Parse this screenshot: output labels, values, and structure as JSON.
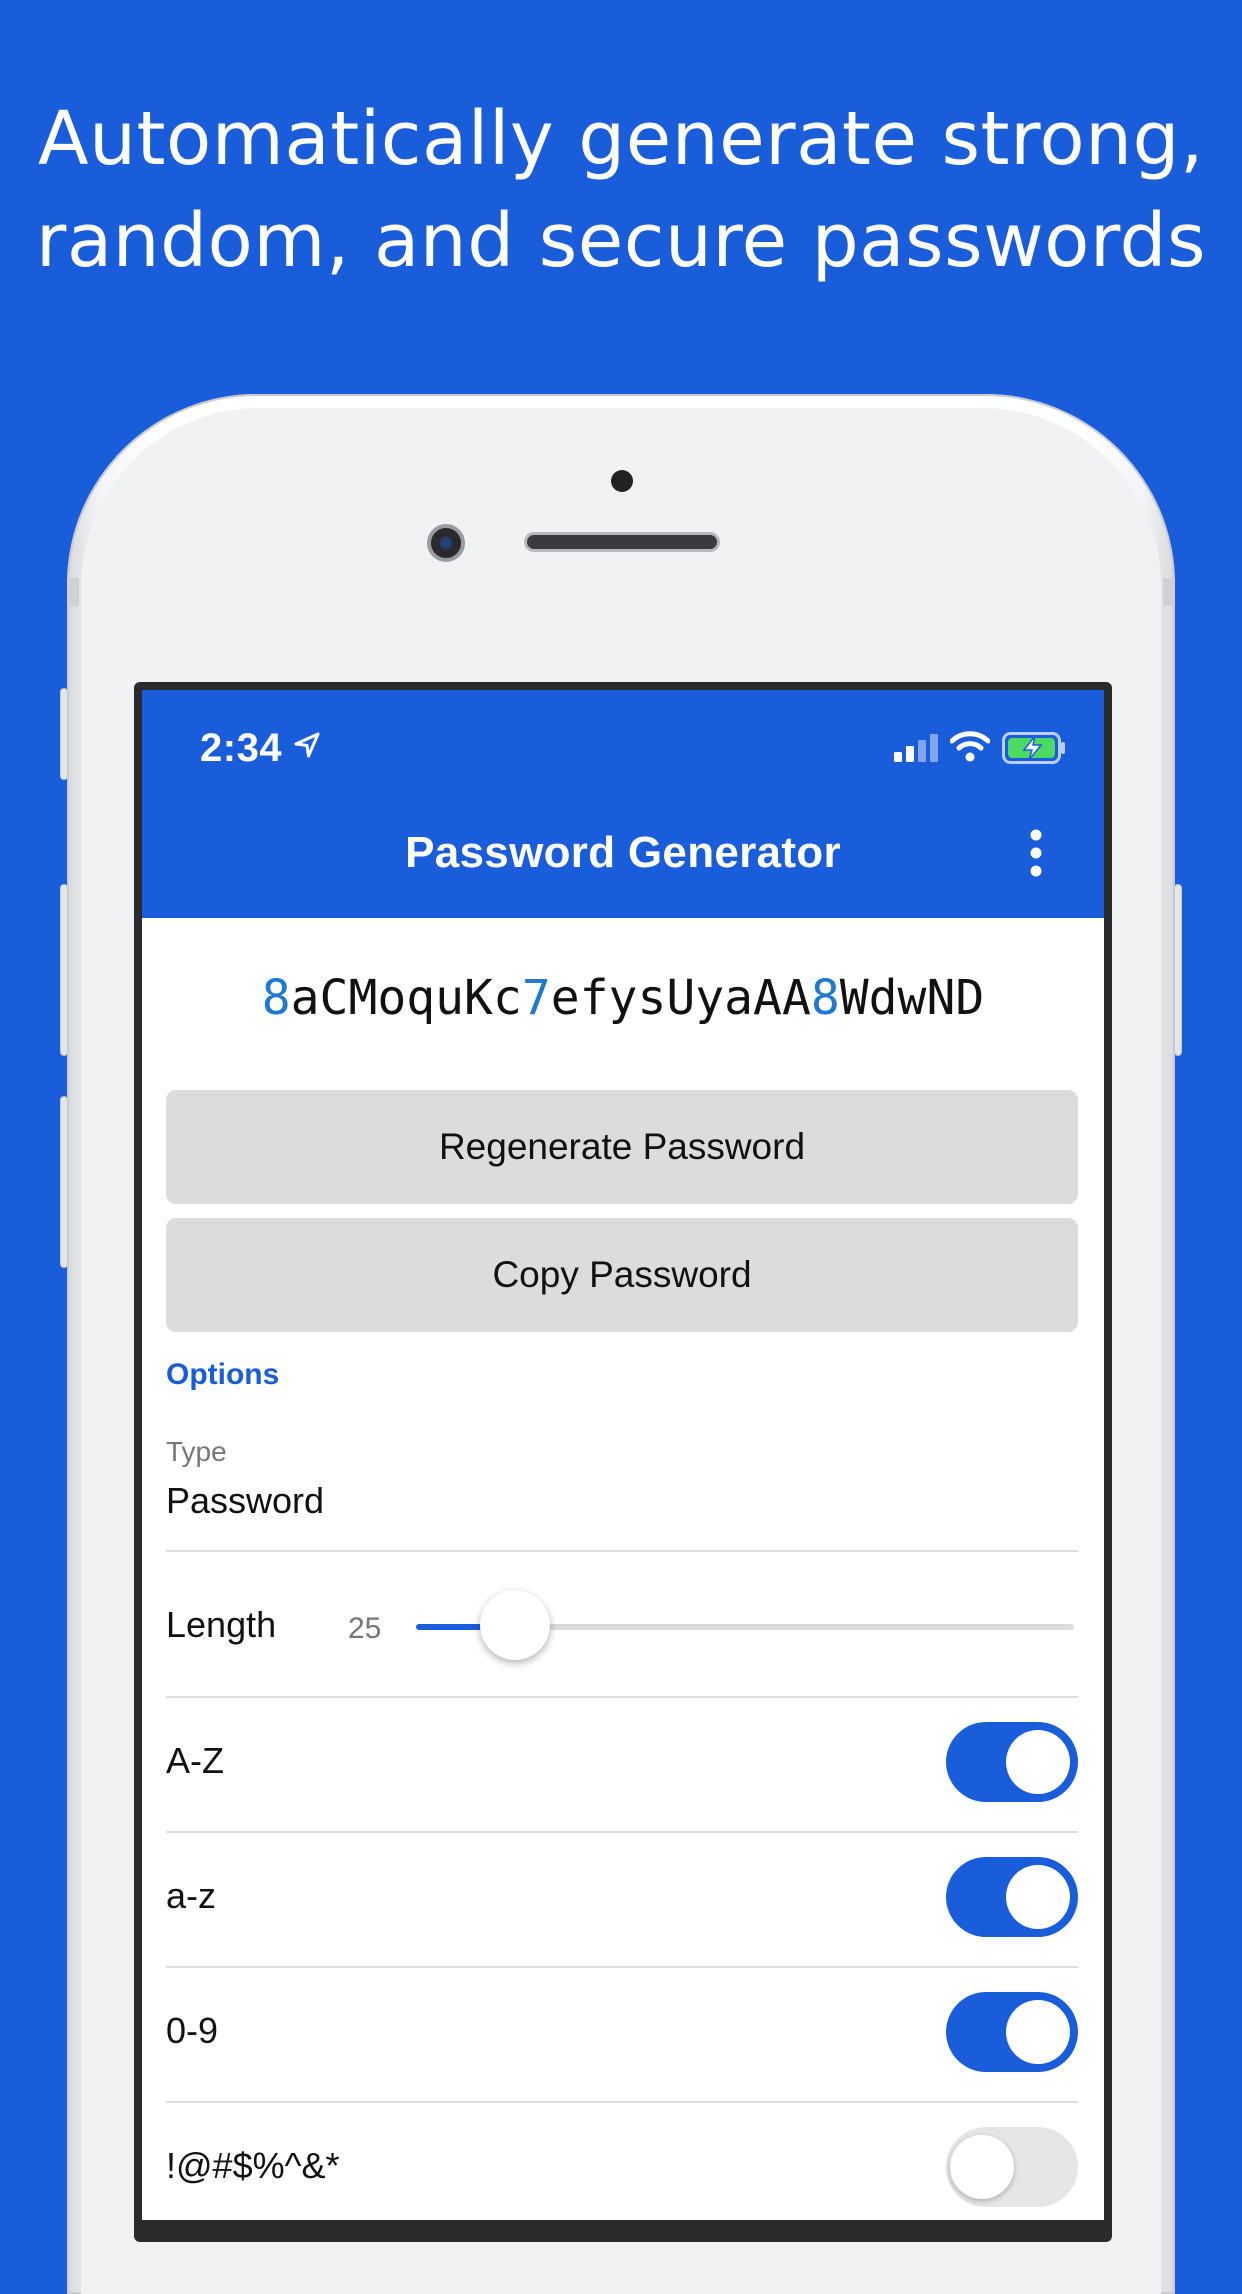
{
  "headline": {
    "line1": "Automatically generate strong,",
    "line2": "random, and secure passwords"
  },
  "status_bar": {
    "time": "2:34"
  },
  "app_bar": {
    "title": "Password Generator"
  },
  "password": {
    "segments": [
      {
        "text": "8",
        "digit": true
      },
      {
        "text": "aCMoquKc",
        "digit": false
      },
      {
        "text": "7",
        "digit": true
      },
      {
        "text": "efysUyaAA",
        "digit": false
      },
      {
        "text": "8",
        "digit": true
      },
      {
        "text": "WdwND",
        "digit": false
      }
    ]
  },
  "buttons": {
    "regenerate": "Regenerate Password",
    "copy": "Copy Password"
  },
  "options": {
    "header": "Options",
    "type_label": "Type",
    "type_value": "Password",
    "length_label": "Length",
    "length_value": "25",
    "length_fraction": 0.15,
    "toggles": [
      {
        "label": "A-Z",
        "on": true
      },
      {
        "label": "a-z",
        "on": true
      },
      {
        "label": "0-9",
        "on": true
      },
      {
        "label": "!@#$%^&*",
        "on": false
      }
    ]
  },
  "colors": {
    "brand": "#1a5ddb",
    "digit": "#1f78d1",
    "button_bg": "#dcdcdc"
  }
}
